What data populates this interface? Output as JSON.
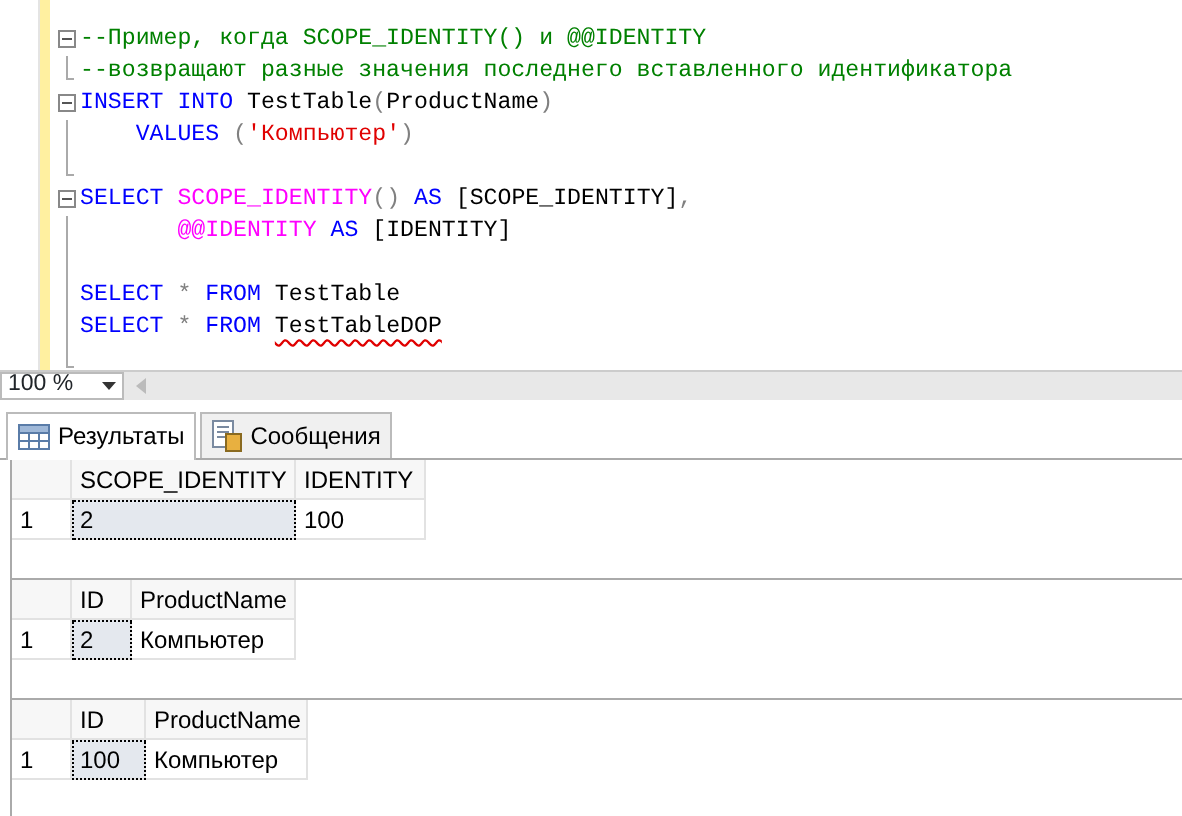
{
  "editor": {
    "lines": [
      {
        "kind": "open",
        "tokens": [
          {
            "kind": "comment",
            "text": "--Пример, когда SCOPE_IDENTITY() и @@IDENTITY"
          }
        ]
      },
      {
        "kind": "end",
        "tokens": [
          {
            "kind": "comment",
            "text": "--возвращают разные значения последнего вставленного идентификатора"
          }
        ]
      },
      {
        "kind": "open",
        "tokens": [
          {
            "kind": "keyword",
            "text": "INSERT"
          },
          {
            "kind": "keyword",
            "text": " INTO"
          },
          {
            "kind": "plain",
            "text": " TestTable"
          },
          {
            "kind": "punct",
            "text": "("
          },
          {
            "kind": "plain",
            "text": "ProductName"
          },
          {
            "kind": "punct",
            "text": ")"
          }
        ]
      },
      {
        "kind": "mid",
        "tokens": [
          {
            "kind": "keyword",
            "text": "    VALUES"
          },
          {
            "kind": "punct",
            "text": " ("
          },
          {
            "kind": "string",
            "text": "'Компьютер'"
          },
          {
            "kind": "punct",
            "text": ")"
          }
        ]
      },
      {
        "kind": "end"
      },
      {
        "kind": "open",
        "tokens": [
          {
            "kind": "keyword",
            "text": "SELECT"
          },
          {
            "kind": "function",
            "text": " SCOPE_IDENTITY"
          },
          {
            "kind": "punct",
            "text": "()"
          },
          {
            "kind": "keyword",
            "text": " AS"
          },
          {
            "kind": "plain",
            "text": " [SCOPE_IDENTITY]"
          },
          {
            "kind": "punct",
            "text": ","
          }
        ]
      },
      {
        "kind": "mid",
        "tokens": [
          {
            "kind": "function",
            "text": "       @@IDENTITY"
          },
          {
            "kind": "keyword",
            "text": " AS"
          },
          {
            "kind": "plain",
            "text": " [IDENTITY]"
          }
        ]
      },
      {
        "kind": "mid"
      },
      {
        "kind": "mid",
        "tokens": [
          {
            "kind": "keyword",
            "text": "SELECT"
          },
          {
            "kind": "punct",
            "text": " *"
          },
          {
            "kind": "keyword",
            "text": " FROM"
          },
          {
            "kind": "plain",
            "text": " TestTable"
          }
        ]
      },
      {
        "kind": "mid",
        "tokens": [
          {
            "kind": "keyword",
            "text": "SELECT"
          },
          {
            "kind": "punct",
            "text": " *"
          },
          {
            "kind": "keyword",
            "text": " FROM "
          },
          {
            "kind": "error",
            "text": "TestTableDOP"
          }
        ]
      },
      {
        "kind": "end"
      }
    ]
  },
  "zoom": {
    "value": "100 %"
  },
  "tabs": [
    {
      "label": "Результаты",
      "selected": true,
      "kind": "grid"
    },
    {
      "label": "Сообщения",
      "selected": false,
      "kind": "messages"
    }
  ],
  "grids": [
    {
      "columns": [
        "SCOPE_IDENTITY",
        "IDENTITY"
      ],
      "rows": [
        {
          "number": "1",
          "cells": [
            {
              "text": "2",
              "selected": true
            },
            {
              "text": "100",
              "selected": false
            }
          ]
        }
      ]
    },
    {
      "columns": [
        "ID",
        "ProductName"
      ],
      "rows": [
        {
          "number": "1",
          "cells": [
            {
              "text": "2",
              "selected": true
            },
            {
              "text": "Компьютер",
              "selected": false
            }
          ]
        }
      ]
    },
    {
      "columns": [
        "ID",
        "ProductName"
      ],
      "rows": [
        {
          "number": "1",
          "cells": [
            {
              "text": "100",
              "selected": true
            },
            {
              "text": "Компьютер",
              "selected": false
            }
          ]
        }
      ]
    }
  ]
}
